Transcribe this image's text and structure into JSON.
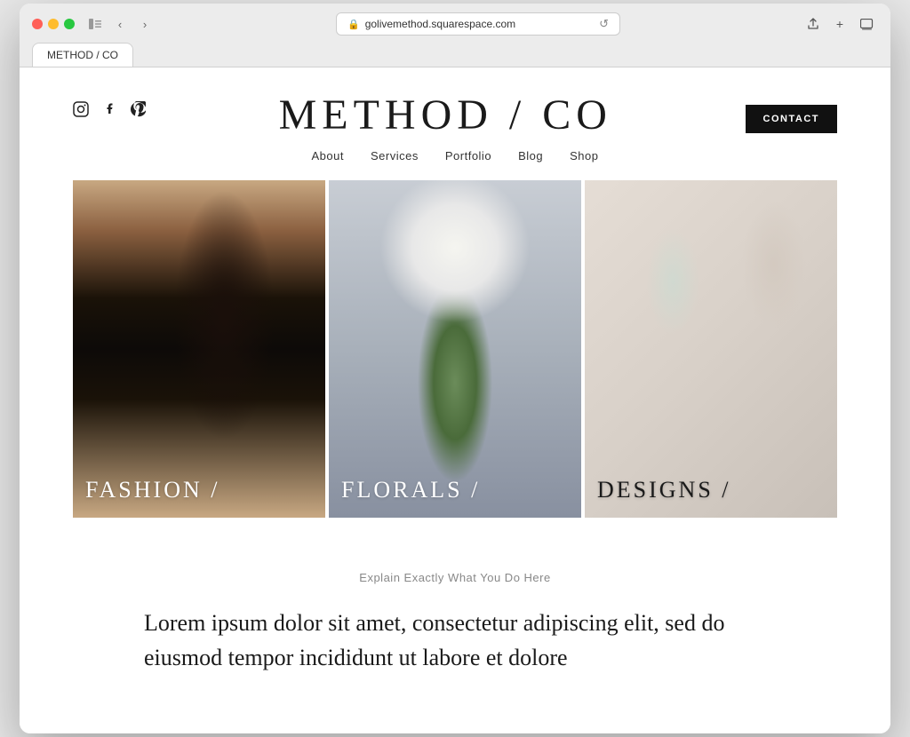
{
  "browser": {
    "url": "golivemethod.squarespace.com",
    "tab_title": "METHOD / CO"
  },
  "header": {
    "site_title": "METHOD / CO",
    "contact_label": "CONTACT",
    "social": {
      "instagram_label": "instagram-icon",
      "facebook_label": "facebook-icon",
      "pinterest_label": "pinterest-icon"
    }
  },
  "nav": {
    "items": [
      {
        "label": "About"
      },
      {
        "label": "Services"
      },
      {
        "label": "Portfolio"
      },
      {
        "label": "Blog"
      },
      {
        "label": "Shop"
      }
    ]
  },
  "gallery": {
    "items": [
      {
        "label": "FASHION /",
        "alt": "Fashion photo - woman with earring"
      },
      {
        "label": "FLORALS /",
        "alt": "Florals photo - hands holding white flower"
      },
      {
        "label": "DESIGNS /",
        "alt": "Designs photo - glasses and macarons"
      }
    ]
  },
  "content": {
    "subtitle": "Explain Exactly What You Do Here",
    "body": "Lorem ipsum dolor sit amet, consectetur adipiscing elit, sed do eiusmod tempor incididunt ut labore et dolore"
  }
}
